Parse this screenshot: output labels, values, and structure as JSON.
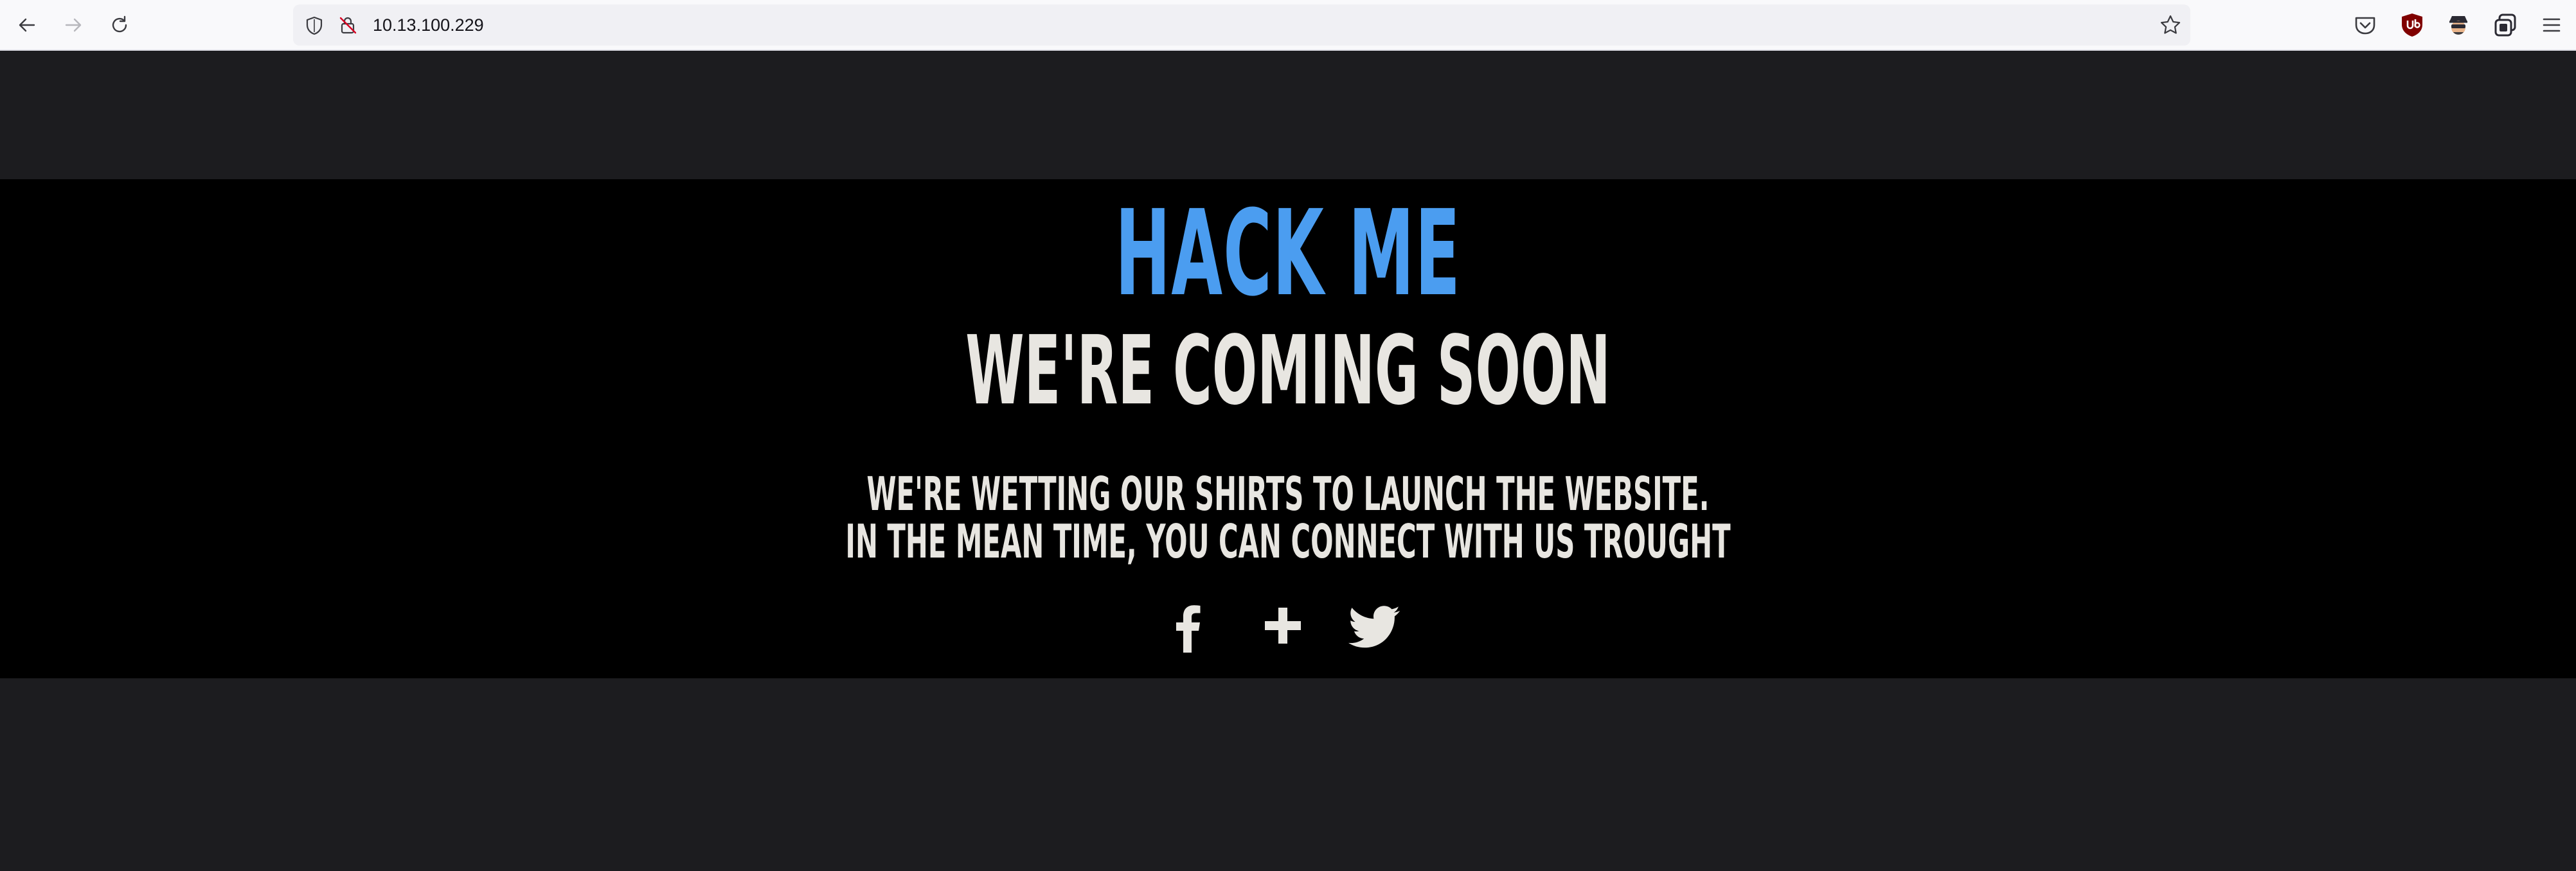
{
  "browser": {
    "url": "10.13.100.229",
    "icons": {
      "back": "arrow-left-icon",
      "forward": "arrow-right-icon",
      "reload": "reload-icon",
      "tracking": "shield-icon",
      "security": "insecure-lock-icon",
      "bookmark": "star-icon",
      "pocket": "pocket-icon",
      "ublock": "ublock-origin-icon",
      "extension": "spy-extension-icon",
      "containers": "container-icon",
      "menu": "hamburger-menu-icon"
    }
  },
  "page": {
    "title": "HACK ME",
    "subtitle": "WE'RE COMING SOON",
    "message_lines": [
      "WE'RE WETTING OUR SHIRTS TO LAUNCH THE WEBSITE.",
      "IN THE MEAN TIME, YOU CAN CONNECT WITH US TROUGHT"
    ],
    "social": [
      "facebook-icon",
      "plus-icon",
      "twitter-icon"
    ],
    "colors": {
      "background": "#1c1c1f",
      "band": "#000000",
      "title": "#4b9df0",
      "text": "#e8e6e1"
    }
  }
}
